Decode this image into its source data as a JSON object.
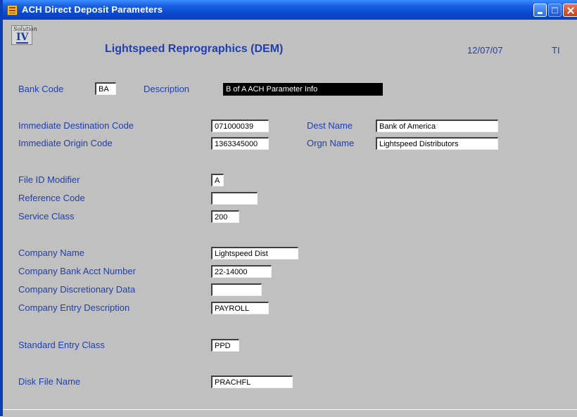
{
  "window": {
    "title": "ACH Direct Deposit Parameters"
  },
  "header": {
    "logo_script": "Solution",
    "logo_numeral": "IV",
    "company": "Lightspeed Reprographics (DEM)",
    "date": "12/07/07",
    "user": "TI"
  },
  "form": {
    "bank_code": {
      "label": "Bank Code",
      "value": "BA"
    },
    "description": {
      "label": "Description",
      "value": "B of A ACH Parameter Info"
    },
    "immediate_destination_code": {
      "label": "Immediate Destination Code",
      "value": "071000039"
    },
    "dest_name": {
      "label": "Dest Name",
      "value": "Bank of America"
    },
    "immediate_origin_code": {
      "label": "Immediate Origin Code",
      "value": "1363345000"
    },
    "orgn_name": {
      "label": "Orgn Name",
      "value": "Lightspeed Distributors"
    },
    "file_id_modifier": {
      "label": "File ID Modifier",
      "value": "A"
    },
    "reference_code": {
      "label": "Reference Code",
      "value": ""
    },
    "service_class": {
      "label": "Service Class",
      "value": "200"
    },
    "company_name": {
      "label": "Company Name",
      "value": "Lightspeed Dist"
    },
    "company_bank_acct_number": {
      "label": "Company Bank Acct Number",
      "value": "22-14000"
    },
    "company_discretionary_data": {
      "label": "Company Discretionary Data",
      "value": ""
    },
    "company_entry_description": {
      "label": "Company Entry Description",
      "value": "PAYROLL"
    },
    "standard_entry_class": {
      "label": "Standard Entry Class",
      "value": "PPD"
    },
    "disk_file_name": {
      "label": "Disk File Name",
      "value": "PRACHFL"
    }
  },
  "colors": {
    "label_blue": "#1f3fb0",
    "window_gray": "#c0c0c0",
    "titlebar_blue": "#0a47d0"
  },
  "icons": [
    "app-table-icon",
    "minimize-icon",
    "maximize-icon",
    "close-icon",
    "solution-iv-logo"
  ]
}
